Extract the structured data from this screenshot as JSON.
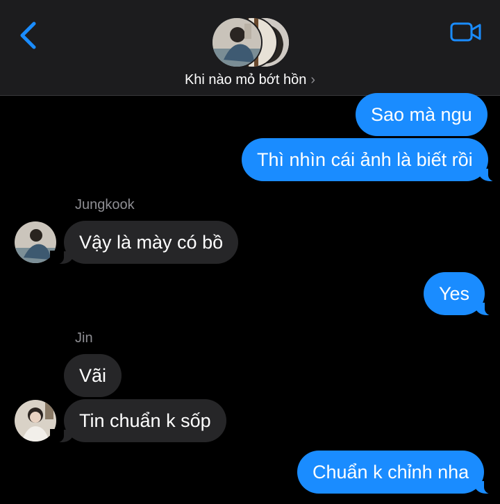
{
  "header": {
    "group_name": "Khi nào mỏ bớt hồn",
    "chevron": "›",
    "back_icon": "chevron-left-icon",
    "video_icon": "video-camera-icon",
    "accent_color": "#1a8cff"
  },
  "messages": [
    {
      "direction": "out",
      "text": "Sao mà ngu"
    },
    {
      "direction": "out",
      "text": "Thì nhìn cái ảnh là biết rồi"
    },
    {
      "direction": "in",
      "sender": "Jungkook",
      "text": "Vậy là mày có bồ"
    },
    {
      "direction": "out",
      "text": "Yes"
    },
    {
      "direction": "in",
      "sender": "Jin",
      "text": "Vãi"
    },
    {
      "direction": "in",
      "text": "Tin chuẩn k sốp"
    },
    {
      "direction": "out",
      "text": "Chuẩn k chỉnh nha"
    }
  ],
  "colors": {
    "outgoing_bubble": "#1a8cff",
    "incoming_bubble": "#262628",
    "background": "#000000",
    "header_background": "#1c1c1e"
  }
}
